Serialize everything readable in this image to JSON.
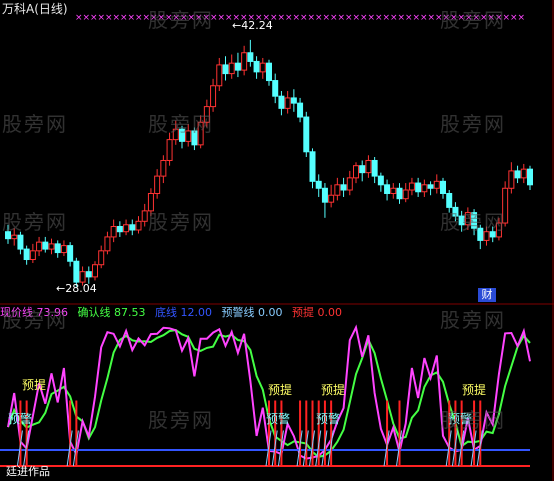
{
  "title": "万科A(日线)",
  "watermark": "股旁网",
  "author": "廷进作品",
  "cai_badge": "财",
  "high_label": "42.24",
  "low_label": "28.04",
  "indicator": {
    "items": [
      {
        "name": "现价线",
        "value": "73.96",
        "color": "#ff44ff"
      },
      {
        "name": "确认线",
        "value": "87.53",
        "color": "#44ff44"
      },
      {
        "name": "底线",
        "value": "12.00",
        "color": "#3355ff"
      },
      {
        "name": "预警线",
        "value": "0.00",
        "color": "#88ccff"
      },
      {
        "name": "预提",
        "value": "0.00",
        "color": "#ff3333"
      }
    ]
  },
  "signals": {
    "yuti": "预提",
    "yujing": "预警"
  },
  "colors": {
    "up": "#ff3333",
    "down": "#55ffff",
    "grid": "#800000"
  },
  "chart_data": {
    "type": "candlestick",
    "x_markers": "×",
    "candles": [
      [
        31.2,
        30.8,
        31.6,
        30.5
      ],
      [
        30.8,
        31.0,
        31.4,
        30.4
      ],
      [
        31.0,
        30.2,
        31.2,
        29.9
      ],
      [
        30.2,
        29.6,
        30.4,
        29.3
      ],
      [
        29.6,
        30.1,
        30.5,
        29.4
      ],
      [
        30.1,
        30.6,
        30.9,
        29.8
      ],
      [
        30.6,
        30.2,
        30.9,
        30.0
      ],
      [
        30.2,
        30.5,
        30.8,
        29.9
      ],
      [
        30.5,
        30.0,
        30.7,
        29.7
      ],
      [
        30.0,
        30.4,
        30.7,
        29.8
      ],
      [
        30.4,
        29.5,
        30.6,
        29.2
      ],
      [
        29.5,
        28.3,
        29.7,
        28.04
      ],
      [
        28.3,
        28.9,
        29.2,
        28.1
      ],
      [
        28.9,
        28.6,
        29.2,
        28.2
      ],
      [
        28.6,
        29.3,
        29.5,
        28.4
      ],
      [
        29.3,
        30.1,
        30.4,
        29.1
      ],
      [
        30.1,
        30.9,
        31.2,
        29.9
      ],
      [
        30.9,
        31.5,
        31.9,
        30.6
      ],
      [
        31.5,
        31.2,
        31.8,
        30.9
      ],
      [
        31.2,
        31.6,
        31.9,
        31.0
      ],
      [
        31.6,
        31.3,
        31.9,
        31.0
      ],
      [
        31.3,
        31.8,
        32.1,
        31.1
      ],
      [
        31.8,
        32.4,
        32.8,
        31.5
      ],
      [
        32.4,
        33.4,
        33.7,
        32.1
      ],
      [
        33.4,
        34.4,
        34.8,
        33.1
      ],
      [
        34.4,
        35.3,
        35.6,
        34.0
      ],
      [
        35.3,
        36.5,
        36.9,
        35.0
      ],
      [
        36.5,
        37.1,
        37.6,
        36.2
      ],
      [
        37.1,
        36.4,
        37.3,
        36.0
      ],
      [
        36.4,
        37.0,
        37.4,
        36.1
      ],
      [
        37.0,
        36.2,
        37.2,
        35.9
      ],
      [
        36.2,
        37.5,
        37.9,
        36.0
      ],
      [
        37.5,
        38.4,
        38.8,
        37.2
      ],
      [
        38.4,
        39.6,
        40.0,
        38.1
      ],
      [
        39.6,
        40.8,
        41.2,
        39.3
      ],
      [
        40.8,
        40.3,
        41.3,
        39.9
      ],
      [
        40.3,
        40.9,
        41.4,
        40.0
      ],
      [
        40.9,
        40.5,
        41.5,
        40.1
      ],
      [
        40.5,
        41.5,
        41.9,
        40.2
      ],
      [
        41.5,
        41.0,
        42.24,
        40.7
      ],
      [
        41.0,
        40.4,
        41.3,
        40.0
      ],
      [
        40.4,
        40.9,
        41.2,
        40.0
      ],
      [
        40.9,
        39.9,
        41.1,
        39.6
      ],
      [
        39.9,
        39.0,
        40.3,
        38.6
      ],
      [
        39.0,
        38.3,
        39.3,
        37.9
      ],
      [
        38.3,
        38.9,
        39.3,
        38.0
      ],
      [
        38.9,
        38.6,
        39.4,
        38.1
      ],
      [
        38.6,
        37.8,
        38.9,
        37.5
      ],
      [
        37.8,
        35.8,
        38.1,
        35.5
      ],
      [
        35.8,
        34.1,
        36.0,
        33.7
      ],
      [
        34.1,
        33.7,
        34.5,
        33.2
      ],
      [
        33.7,
        32.9,
        34.0,
        32.0
      ],
      [
        32.9,
        33.3,
        33.9,
        32.6
      ],
      [
        33.3,
        33.9,
        34.3,
        33.0
      ],
      [
        33.9,
        33.6,
        34.3,
        33.2
      ],
      [
        33.6,
        34.3,
        34.7,
        33.3
      ],
      [
        34.3,
        35.0,
        35.2,
        34.0
      ],
      [
        35.0,
        34.6,
        35.3,
        34.1
      ],
      [
        34.6,
        35.3,
        35.6,
        34.3
      ],
      [
        35.3,
        34.4,
        35.5,
        34.0
      ],
      [
        34.4,
        33.9,
        34.6,
        33.5
      ],
      [
        33.9,
        33.4,
        34.2,
        33.0
      ],
      [
        33.4,
        33.7,
        34.0,
        33.1
      ],
      [
        33.7,
        33.1,
        34.0,
        32.8
      ],
      [
        33.1,
        33.6,
        34.0,
        32.9
      ],
      [
        33.6,
        34.0,
        34.3,
        33.3
      ],
      [
        34.0,
        33.5,
        34.3,
        33.2
      ],
      [
        33.5,
        33.9,
        34.2,
        33.2
      ],
      [
        33.9,
        33.7,
        34.1,
        33.3
      ],
      [
        33.7,
        34.1,
        34.5,
        33.4
      ],
      [
        34.1,
        33.4,
        34.3,
        33.1
      ],
      [
        33.4,
        32.6,
        33.6,
        32.3
      ],
      [
        32.6,
        32.1,
        32.9,
        31.8
      ],
      [
        32.1,
        31.6,
        32.4,
        31.2
      ],
      [
        31.6,
        32.3,
        32.6,
        31.3
      ],
      [
        32.3,
        31.4,
        32.5,
        31.0
      ],
      [
        31.4,
        30.7,
        31.6,
        30.2
      ],
      [
        30.7,
        31.2,
        31.5,
        30.4
      ],
      [
        31.2,
        30.9,
        31.5,
        30.6
      ],
      [
        30.9,
        31.7,
        32.0,
        30.7
      ],
      [
        31.7,
        33.7,
        34.1,
        31.5
      ],
      [
        33.7,
        34.7,
        35.2,
        33.4
      ],
      [
        34.7,
        34.3,
        35.0,
        34.0
      ],
      [
        34.3,
        34.8,
        35.1,
        34.0
      ],
      [
        34.8,
        33.9,
        35.0,
        33.6
      ]
    ]
  }
}
